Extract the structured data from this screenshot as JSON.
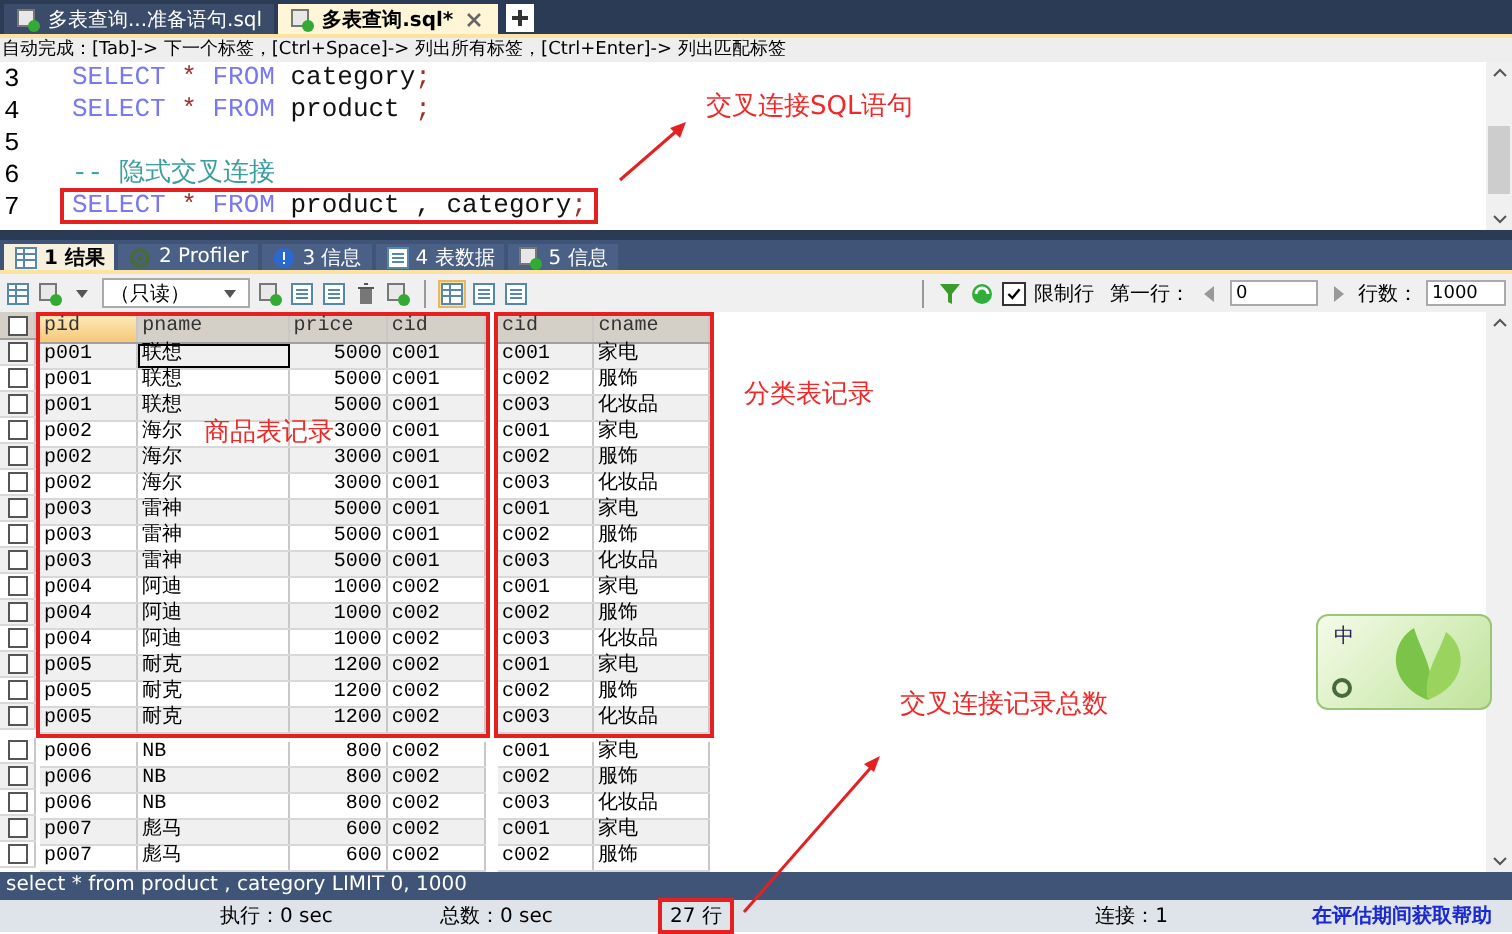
{
  "editor_tabs": [
    {
      "label": "多表查询...准备语句.sql",
      "selected": false
    },
    {
      "label": "多表查询.sql*",
      "selected": true
    }
  ],
  "autocomplete_hint": "自动完成：[Tab]-> 下一个标签，[Ctrl+Space]-> 列出所有标签，[Ctrl+Enter]-> 列出匹配标签",
  "editor": {
    "lines": [
      {
        "number": "3",
        "boxed": false,
        "tokens": [
          {
            "kind": "keyword",
            "text": "SELECT "
          },
          {
            "kind": "operator",
            "text": "* "
          },
          {
            "kind": "keyword",
            "text": "FROM "
          },
          {
            "kind": "plain",
            "text": "category"
          },
          {
            "kind": "operator",
            "text": ";"
          }
        ]
      },
      {
        "number": "4",
        "boxed": false,
        "tokens": [
          {
            "kind": "keyword",
            "text": "SELECT "
          },
          {
            "kind": "operator",
            "text": "* "
          },
          {
            "kind": "keyword",
            "text": "FROM "
          },
          {
            "kind": "plain",
            "text": "product "
          },
          {
            "kind": "operator",
            "text": ";"
          }
        ]
      },
      {
        "number": "5",
        "boxed": false
      },
      {
        "number": "6",
        "boxed": false,
        "tokens": [
          {
            "kind": "comment",
            "text": "-- 隐式交叉连接"
          }
        ]
      },
      {
        "number": "7",
        "boxed": true,
        "tokens": [
          {
            "kind": "keyword",
            "text": "SELECT "
          },
          {
            "kind": "operator",
            "text": "* "
          },
          {
            "kind": "keyword",
            "text": "FROM "
          },
          {
            "kind": "plain",
            "text": "product , category"
          },
          {
            "kind": "operator",
            "text": ";"
          }
        ]
      }
    ],
    "callout": "交叉连接SQL语句"
  },
  "result_tabs": [
    {
      "label": "1 结果",
      "selected": true
    },
    {
      "label": "2 Profiler",
      "selected": false
    },
    {
      "label": "3 信息",
      "selected": false
    },
    {
      "label": "4 表数据",
      "selected": false
    },
    {
      "label": "5 信息",
      "selected": false
    }
  ],
  "toolbar": {
    "mode": "（只读）",
    "limit_rows": {
      "label": "限制行",
      "checked": true
    },
    "first_row_label": "第一行：",
    "first_row": "0",
    "row_count_label": "行数：",
    "row_count": "1000"
  },
  "table": {
    "all_checked": false,
    "column_groups": [
      {
        "boxed": true,
        "callout": "商品表记录",
        "columns": [
          "pid",
          "pname",
          "price",
          "cid"
        ]
      },
      {
        "boxed": true,
        "callout": "分类表记录",
        "columns": [
          "cid",
          "cname"
        ]
      }
    ],
    "rows": [
      {
        "checked": false,
        "cells": [
          "p001",
          "联想",
          "5000",
          "c001",
          "c001",
          "家电"
        ]
      },
      {
        "checked": false,
        "cells": [
          "p001",
          "联想",
          "5000",
          "c001",
          "c002",
          "服饰"
        ]
      },
      {
        "checked": false,
        "cells": [
          "p001",
          "联想",
          "5000",
          "c001",
          "c003",
          "化妆品"
        ]
      },
      {
        "checked": false,
        "cells": [
          "p002",
          "海尔",
          "3000",
          "c001",
          "c001",
          "家电"
        ]
      },
      {
        "checked": false,
        "cells": [
          "p002",
          "海尔",
          "3000",
          "c001",
          "c002",
          "服饰"
        ]
      },
      {
        "checked": false,
        "cells": [
          "p002",
          "海尔",
          "3000",
          "c001",
          "c003",
          "化妆品"
        ]
      },
      {
        "checked": false,
        "cells": [
          "p003",
          "雷神",
          "5000",
          "c001",
          "c001",
          "家电"
        ]
      },
      {
        "checked": false,
        "cells": [
          "p003",
          "雷神",
          "5000",
          "c001",
          "c002",
          "服饰"
        ]
      },
      {
        "checked": false,
        "cells": [
          "p003",
          "雷神",
          "5000",
          "c001",
          "c003",
          "化妆品"
        ]
      },
      {
        "checked": false,
        "cells": [
          "p004",
          "阿迪",
          "1000",
          "c002",
          "c001",
          "家电"
        ]
      },
      {
        "checked": false,
        "cells": [
          "p004",
          "阿迪",
          "1000",
          "c002",
          "c002",
          "服饰"
        ]
      },
      {
        "checked": false,
        "cells": [
          "p004",
          "阿迪",
          "1000",
          "c002",
          "c003",
          "化妆品"
        ]
      },
      {
        "checked": false,
        "cells": [
          "p005",
          "耐克",
          "1200",
          "c002",
          "c001",
          "家电"
        ]
      },
      {
        "checked": false,
        "cells": [
          "p005",
          "耐克",
          "1200",
          "c002",
          "c002",
          "服饰"
        ]
      },
      {
        "checked": false,
        "cells": [
          "p005",
          "耐克",
          "1200",
          "c002",
          "c003",
          "化妆品"
        ]
      }
    ],
    "rows_below_frames": [
      {
        "checked": false,
        "cells": [
          "p006",
          "NB",
          "800",
          "c002",
          "c001",
          "家电"
        ]
      },
      {
        "checked": false,
        "cells": [
          "p006",
          "NB",
          "800",
          "c002",
          "c002",
          "服饰"
        ]
      },
      {
        "checked": false,
        "cells": [
          "p006",
          "NB",
          "800",
          "c002",
          "c003",
          "化妆品"
        ]
      },
      {
        "checked": false,
        "cells": [
          "p007",
          "彪马",
          "600",
          "c002",
          "c001",
          "家电"
        ]
      },
      {
        "checked": false,
        "cells": [
          "p007",
          "彪马",
          "600",
          "c002",
          "c002",
          "服饰"
        ]
      }
    ]
  },
  "ime_widget": {
    "mode": "中"
  },
  "query_bar": "select * from product , category LIMIT 0, 1000",
  "status_bar": {
    "items": [
      {
        "kind": "text",
        "text": "执行：0 sec",
        "boxed": false
      },
      {
        "kind": "text",
        "text": "总数：0 sec",
        "boxed": false
      },
      {
        "kind": "text",
        "text": "27 行",
        "boxed": true
      },
      {
        "kind": "text",
        "text": "连接：1",
        "boxed": false
      },
      {
        "kind": "link",
        "text": "在评估期间获取帮助",
        "boxed": false
      }
    ],
    "callout": "交叉连接记录总数"
  }
}
